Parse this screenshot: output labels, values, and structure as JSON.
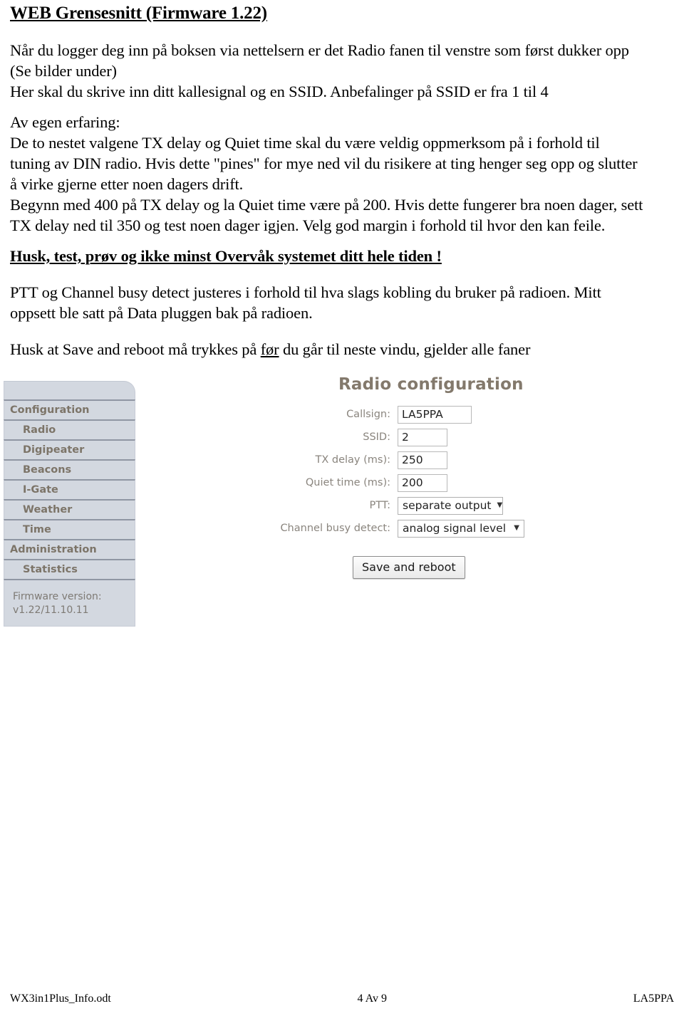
{
  "document": {
    "title": "WEB Grensesnitt (Firmware 1.22)",
    "paragraphs": {
      "p1_line1": "Når du logger deg inn på boksen via nettelsern er det Radio fanen til venstre som først dukker opp",
      "p1_line2": "(Se bilder under)",
      "p1_line3": "Her skal du skrive inn ditt kallesignal og en SSID. Anbefalinger på SSID er fra 1 til 4",
      "p2_line1": "Av egen erfaring:",
      "p2_line2": "De to nestet valgene TX delay og Quiet time skal du være veldig oppmerksom på i forhold til",
      "p2_line3": "tuning av DIN radio. Hvis dette \"pines\" for mye ned vil du risikere at ting henger seg opp og slutter",
      "p2_line4": "å virke gjerne etter noen dagers drift.",
      "p2_line5": "Begynn med 400 på TX delay og la Quiet time være på 200. Hvis dette fungerer bra noen dager, sett",
      "p2_line6": "TX delay ned til 350 og test noen dager igjen. Velg god margin i forhold til hvor den kan feile.",
      "warning": "Husk, test, prøv og ikke minst Overvåk systemet ditt hele tiden !",
      "p4_line1": "PTT og Channel busy detect justeres i forhold til hva slags kobling du bruker på radioen. Mitt",
      "p4_line2": "oppsett ble satt på Data pluggen bak på radioen.",
      "p5_before": "Husk at Save and reboot må trykkes på ",
      "p5_underlined": "før",
      "p5_after": " du går til neste vindu, gjelder alle faner"
    }
  },
  "screenshot": {
    "sidebar": {
      "items": [
        {
          "label": "Configuration",
          "level": 1
        },
        {
          "label": "Radio",
          "level": 2
        },
        {
          "label": "Digipeater",
          "level": 2
        },
        {
          "label": "Beacons",
          "level": 2
        },
        {
          "label": "I-Gate",
          "level": 2
        },
        {
          "label": "Weather",
          "level": 2
        },
        {
          "label": "Time",
          "level": 2
        },
        {
          "label": "Administration",
          "level": 1
        },
        {
          "label": "Statistics",
          "level": 2
        }
      ],
      "firmware_label": "Firmware version:",
      "firmware_value": "v1.22/11.10.11"
    },
    "form": {
      "title": "Radio configuration",
      "fields": [
        {
          "label": "Callsign:",
          "value": "LA5PPA",
          "type": "text"
        },
        {
          "label": "SSID:",
          "value": "2",
          "type": "text"
        },
        {
          "label": "TX delay (ms):",
          "value": "250",
          "type": "text"
        },
        {
          "label": "Quiet time (ms):",
          "value": "200",
          "type": "text"
        },
        {
          "label": "PTT:",
          "value": "separate output",
          "type": "select"
        },
        {
          "label": "Channel busy detect:",
          "value": "analog signal level",
          "type": "select"
        }
      ],
      "caret": "▼",
      "save_label": "Save and reboot"
    },
    "colors": {
      "sidebar_bg": "#d3d8e0",
      "sidebar_text": "#7c7468",
      "panel_title": "#83796c",
      "form_label": "#8a857e"
    }
  },
  "footer": {
    "left": "WX3in1Plus_Info.odt",
    "center": "4 Av 9",
    "right": "LA5PPA"
  }
}
